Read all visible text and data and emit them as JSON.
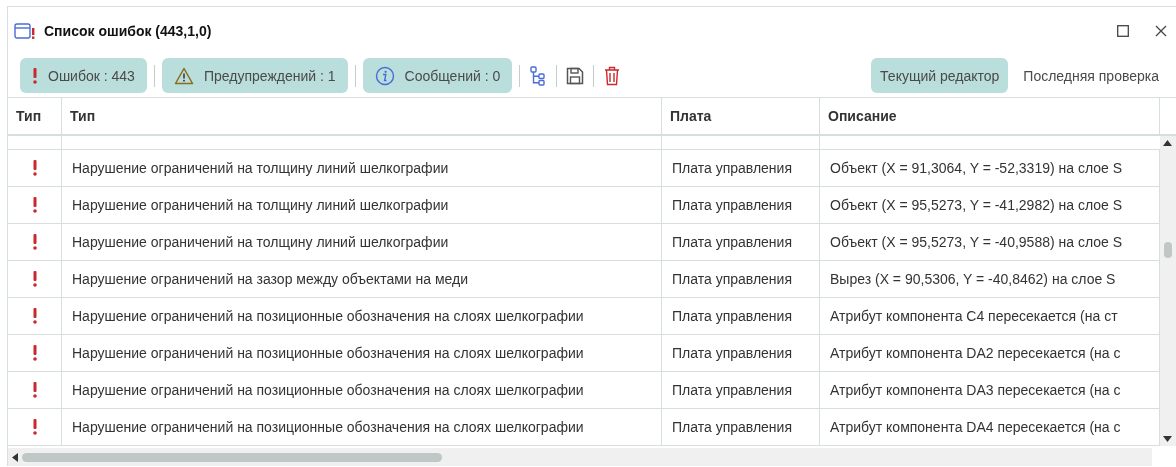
{
  "window": {
    "title": "Список ошибок (443,1,0)"
  },
  "filters": [
    {
      "kind": "error",
      "label": "Ошибок : 443",
      "selected": true
    },
    {
      "kind": "warning",
      "label": "Предупреждений : 1",
      "selected": true
    },
    {
      "kind": "info",
      "label": "Сообщений : 0",
      "selected": true
    }
  ],
  "views": [
    {
      "label": "Текущий редактор",
      "selected": true
    },
    {
      "label": "Последняя проверка",
      "selected": false
    }
  ],
  "table": {
    "columns": [
      "Тип",
      "Тип",
      "Плата",
      "Описание"
    ],
    "rows": [
      {
        "kind": "error",
        "type": "Нарушение ограничений на толщину линий шелкографии",
        "board": "Плата управления",
        "description": "Объект (X = 91,3064, Y = -52,3319) на слое S"
      },
      {
        "kind": "error",
        "type": "Нарушение ограничений на толщину линий шелкографии",
        "board": "Плата управления",
        "description": "Объект (X = 95,5273, Y = -41,2982) на слое S"
      },
      {
        "kind": "error",
        "type": "Нарушение ограничений на толщину линий шелкографии",
        "board": "Плата управления",
        "description": "Объект (X = 95,5273, Y = -40,9588) на слое S"
      },
      {
        "kind": "error",
        "type": "Нарушение ограничений на зазор между объектами на меди",
        "board": "Плата управления",
        "description": "Вырез (X = 90,5306, Y = -40,8462) на слое S"
      },
      {
        "kind": "error",
        "type": "Нарушение ограничений на позиционные обозначения на слоях шелкографии",
        "board": "Плата управления",
        "description": "Атрибут компонента C4 пересекается (на ст"
      },
      {
        "kind": "error",
        "type": "Нарушение ограничений на позиционные обозначения на слоях шелкографии",
        "board": "Плата управления",
        "description": "Атрибут компонента DA2 пересекается (на с"
      },
      {
        "kind": "error",
        "type": "Нарушение ограничений на позиционные обозначения на слоях шелкографии",
        "board": "Плата управления",
        "description": "Атрибут компонента DA3 пересекается (на с"
      },
      {
        "kind": "error",
        "type": "Нарушение ограничений на позиционные обозначения на слоях шелкографии",
        "board": "Плата управления",
        "description": "Атрибут компонента DA4 пересекается (на с"
      }
    ]
  }
}
